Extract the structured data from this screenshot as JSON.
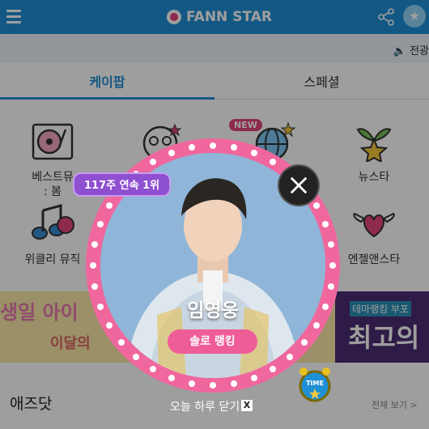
{
  "header": {
    "brand": "FANN STAR",
    "menu_icon": "hamburger-icon",
    "share_icon": "share-icon",
    "star_icon": "star-icon",
    "star_glyph": "★"
  },
  "notice": {
    "text": "🔈 전광"
  },
  "tabs": [
    {
      "label": "케이팝",
      "active": true
    },
    {
      "label": "스페셜",
      "active": false
    }
  ],
  "menu": {
    "items": [
      {
        "label": "베스트뮤",
        "label2": ": 봄",
        "icon": "turntable-icon"
      },
      {
        "label": "",
        "icon": "fan-group-icon"
      },
      {
        "label": "",
        "icon": "globe-stars-icon",
        "badge": "NEW"
      },
      {
        "label": "뉴스타",
        "icon": "sprout-star-icon"
      },
      {
        "label": "위클리 뮤직",
        "icon": "music-chart-icon"
      },
      {
        "label": "엔젤앤스타",
        "icon": "winged-heart-icon"
      }
    ]
  },
  "banner": {
    "left_text": "생일 아이",
    "left_sub": "이달의",
    "right_tag": "테마랭킹 부포",
    "right_text": "최고의"
  },
  "ads": {
    "title": "애즈닷",
    "see_all": "전체 보기 >",
    "timer_icon": "time-alarm-icon",
    "timer_label": "TIME"
  },
  "popup": {
    "badge": "117주 연속 1위",
    "name": "임영웅",
    "rank_button": "솔로 랭킹",
    "close_icon": "close-icon",
    "dismiss_today": "오늘 하루 닫기",
    "dismiss_x": "X"
  },
  "colors": {
    "brand": "#1f8fd6",
    "ring": "#f0679e",
    "badge": "#8e4fd0",
    "rank_button": "#ef5d98"
  }
}
